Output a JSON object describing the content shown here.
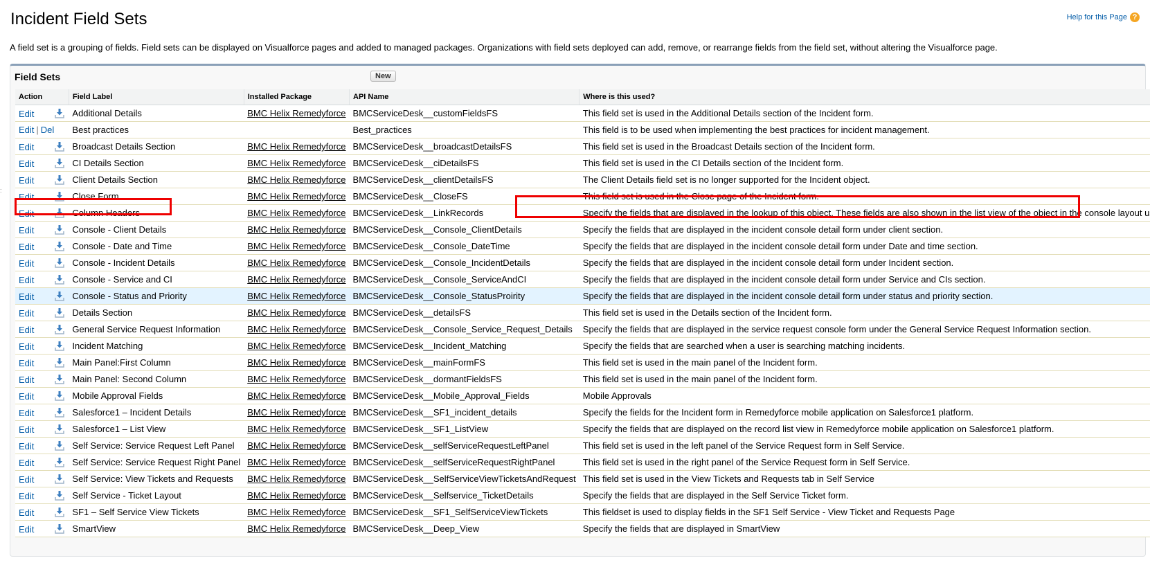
{
  "page": {
    "title": "Incident Field Sets",
    "help_link": "Help for this Page",
    "description": "A field set is a grouping of fields. Field sets can be displayed on Visualforce pages and added to managed packages. Organizations with field sets deployed can add, remove, or rearrange fields from the field set, without altering the Visualforce page."
  },
  "panel": {
    "title": "Field Sets",
    "new_button": "New",
    "columns": [
      "Action",
      "Field Label",
      "Installed Package",
      "API Name",
      "Where is this used?"
    ],
    "action_edit": "Edit",
    "action_del": "Del",
    "rows": [
      {
        "label": "Additional Details",
        "package": "BMC Helix Remedyforce",
        "api": "BMCServiceDesk__customFieldsFS",
        "usage": "This field set is used in the Additional Details section of the Incident form.",
        "deletable": false
      },
      {
        "label": "Best practices",
        "package": "",
        "api": "Best_practices",
        "usage": "This field is to be used when implementing the best practices for incident management.",
        "deletable": true
      },
      {
        "label": "Broadcast Details Section",
        "package": "BMC Helix Remedyforce",
        "api": "BMCServiceDesk__broadcastDetailsFS",
        "usage": "This field set is used in the Broadcast Details section of the Incident form.",
        "deletable": false
      },
      {
        "label": "CI Details Section",
        "package": "BMC Helix Remedyforce",
        "api": "BMCServiceDesk__ciDetailsFS",
        "usage": "This field set is used in the CI Details section of the Incident form.",
        "deletable": false
      },
      {
        "label": "Client Details Section",
        "package": "BMC Helix Remedyforce",
        "api": "BMCServiceDesk__clientDetailsFS",
        "usage": "The Client Details field set is no longer supported for the Incident object.",
        "deletable": false
      },
      {
        "label": "Close Form",
        "package": "BMC Helix Remedyforce",
        "api": "BMCServiceDesk__CloseFS",
        "usage": "This field set is used in the Close page of the Incident form.",
        "deletable": false
      },
      {
        "label": "Column Headers",
        "package": "BMC Helix Remedyforce",
        "api": "BMCServiceDesk__LinkRecords",
        "usage": "Specify the fields that are displayed in the lookup of this object. These fields are also shown in the list view of the object in the console layout user interface.",
        "deletable": false
      },
      {
        "label": "Console - Client Details",
        "package": "BMC Helix Remedyforce",
        "api": "BMCServiceDesk__Console_ClientDetails",
        "usage": "Specify the fields that are displayed in the incident console detail form under client section.",
        "deletable": false
      },
      {
        "label": "Console - Date and Time",
        "package": "BMC Helix Remedyforce",
        "api": "BMCServiceDesk__Console_DateTime",
        "usage": "Specify the fields that are displayed in the incident console detail form under Date and time section.",
        "deletable": false
      },
      {
        "label": "Console - Incident Details",
        "package": "BMC Helix Remedyforce",
        "api": "BMCServiceDesk__Console_IncidentDetails",
        "usage": "Specify the fields that are displayed in the incident console detail form under Incident section.",
        "deletable": false
      },
      {
        "label": "Console - Service and CI",
        "package": "BMC Helix Remedyforce",
        "api": "BMCServiceDesk__Console_ServiceAndCI",
        "usage": "Specify the fields that are displayed in the incident console detail form under Service and CIs section.",
        "deletable": false
      },
      {
        "label": "Console - Status and Priority",
        "package": "BMC Helix Remedyforce",
        "api": "BMCServiceDesk__Console_StatusProirity",
        "usage": "Specify the fields that are displayed in the incident console detail form under status and priority section.",
        "deletable": false
      },
      {
        "label": "Details Section",
        "package": "BMC Helix Remedyforce",
        "api": "BMCServiceDesk__detailsFS",
        "usage": "This field set is used in the Details section of the Incident form.",
        "deletable": false
      },
      {
        "label": "General Service Request Information",
        "package": "BMC Helix Remedyforce",
        "api": "BMCServiceDesk__Console_Service_Request_Details",
        "usage": "Specify the fields that are displayed in the service request console form under the General Service Request Information section.",
        "deletable": false
      },
      {
        "label": "Incident Matching",
        "package": "BMC Helix Remedyforce",
        "api": "BMCServiceDesk__Incident_Matching",
        "usage": "Specify the fields that are searched when a user is searching matching incidents.",
        "deletable": false
      },
      {
        "label": "Main Panel:First Column",
        "package": "BMC Helix Remedyforce",
        "api": "BMCServiceDesk__mainFormFS",
        "usage": "This field set is used in the main panel of the Incident form.",
        "deletable": false
      },
      {
        "label": "Main Panel: Second Column",
        "package": "BMC Helix Remedyforce",
        "api": "BMCServiceDesk__dormantFieldsFS",
        "usage": "This field set is used in the main panel of the Incident form.",
        "deletable": false
      },
      {
        "label": "Mobile Approval Fields",
        "package": "BMC Helix Remedyforce",
        "api": "BMCServiceDesk__Mobile_Approval_Fields",
        "usage": "Mobile Approvals",
        "deletable": false
      },
      {
        "label": "Salesforce1 – Incident Details",
        "package": "BMC Helix Remedyforce",
        "api": "BMCServiceDesk__SF1_incident_details",
        "usage": "Specify the fields for the Incident form in Remedyforce mobile application on Salesforce1 platform.",
        "deletable": false
      },
      {
        "label": "Salesforce1 – List View",
        "package": "BMC Helix Remedyforce",
        "api": "BMCServiceDesk__SF1_ListView",
        "usage": "Specify the fields that are displayed on the record list view in Remedyforce mobile application on Salesforce1 platform.",
        "deletable": false
      },
      {
        "label": "Self Service: Service Request Left Panel",
        "package": "BMC Helix Remedyforce",
        "api": "BMCServiceDesk__selfServiceRequestLeftPanel",
        "usage": "This field set is used in the left panel of the Service Request form in Self Service.",
        "deletable": false
      },
      {
        "label": "Self Service: Service Request Right Panel",
        "package": "BMC Helix Remedyforce",
        "api": "BMCServiceDesk__selfServiceRequestRightPanel",
        "usage": "This field set is used in the right panel of the Service Request form in Self Service.",
        "deletable": false
      },
      {
        "label": "Self Service: View Tickets and Requests",
        "package": "BMC Helix Remedyforce",
        "api": "BMCServiceDesk__SelfServiceViewTicketsAndRequest",
        "usage": "This field set is used in the View Tickets and Requests tab in Self Service",
        "deletable": false
      },
      {
        "label": "Self Service - Ticket Layout",
        "package": "BMC Helix Remedyforce",
        "api": "BMCServiceDesk__Selfservice_TicketDetails",
        "usage": "Specify the fields that are displayed in the Self Service Ticket form.",
        "deletable": false
      },
      {
        "label": "SF1 – Self Service View Tickets",
        "package": "BMC Helix Remedyforce",
        "api": "BMCServiceDesk__SF1_SelfServiceViewTickets",
        "usage": "This fieldset is used to display fields in the SF1 Self Service - View Ticket and Requests Page",
        "deletable": false
      },
      {
        "label": "SmartView",
        "package": "BMC Helix Remedyforce",
        "api": "BMCServiceDesk__Deep_View",
        "usage": "Specify the fields that are displayed in SmartView",
        "deletable": false
      }
    ]
  },
  "colors": {
    "link": "#015ba7",
    "hover_row": "#e3f3ff",
    "highlight_box": "#ee0000",
    "help_icon": "#f5a623"
  },
  "icons": {
    "help": "help-question-icon",
    "download": "download-arrow-icon"
  }
}
